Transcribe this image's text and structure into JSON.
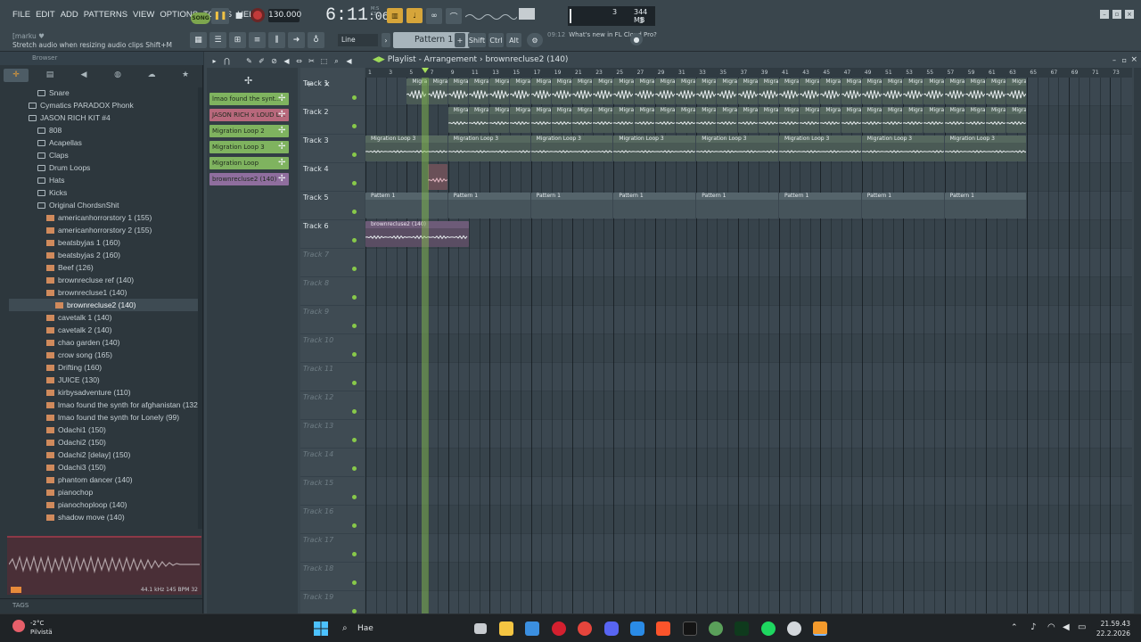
{
  "menu": [
    "FILE",
    "EDIT",
    "ADD",
    "PATTERNS",
    "VIEW",
    "OPTIONS",
    "TOOLS",
    "HELP"
  ],
  "hint": {
    "user": "[marku ♥",
    "text": "Stretch audio when resizing audio clips  Shift+M"
  },
  "transport": {
    "song_label": "SONG",
    "tempo": "130.000",
    "time_main": "6:11",
    "time_small": ":06",
    "time_unit_m": "M:S",
    "time_unit_cs": "CS"
  },
  "cpu": {
    "v1": "3",
    "v2": "344 MB",
    "v3": "3"
  },
  "toolbar2": {
    "snap": "Line",
    "pattern": "Pattern 1",
    "keys": [
      "Shift",
      "Ctrl",
      "Alt"
    ],
    "news_time": "09:12",
    "news_text": "What's new in FL Cloud Pro?"
  },
  "browser": {
    "title": "Browser",
    "tree": [
      {
        "label": "Snare",
        "type": "folder",
        "indent": 1
      },
      {
        "label": "Cymatics PARADOX Phonk",
        "type": "folder",
        "indent": 0
      },
      {
        "label": "JASON RICH KIT #4",
        "type": "folder",
        "indent": 0
      },
      {
        "label": "808",
        "type": "folder",
        "indent": 1
      },
      {
        "label": "Acapellas",
        "type": "folder",
        "indent": 1
      },
      {
        "label": "Claps",
        "type": "folder",
        "indent": 1
      },
      {
        "label": "Drum Loops",
        "type": "folder",
        "indent": 1
      },
      {
        "label": "Hats",
        "type": "folder",
        "indent": 1
      },
      {
        "label": "Kicks",
        "type": "folder",
        "indent": 1
      },
      {
        "label": "Original ChordsnShit",
        "type": "folder",
        "indent": 1
      },
      {
        "label": "americanhorrorstory 1 (155)",
        "type": "file",
        "indent": 2
      },
      {
        "label": "americanhorrorstory 2 (155)",
        "type": "file",
        "indent": 2
      },
      {
        "label": "beatsbyjas 1 (160)",
        "type": "file",
        "indent": 2
      },
      {
        "label": "beatsbyjas 2 (160)",
        "type": "file",
        "indent": 2
      },
      {
        "label": "Beef (126)",
        "type": "file",
        "indent": 2
      },
      {
        "label": "brownrecluse ref (140)",
        "type": "file",
        "indent": 2
      },
      {
        "label": "brownrecluse1 (140)",
        "type": "file",
        "indent": 2
      },
      {
        "label": "brownrecluse2 (140)",
        "type": "file",
        "indent": 3,
        "selected": true
      },
      {
        "label": "cavetalk 1 (140)",
        "type": "file",
        "indent": 2
      },
      {
        "label": "cavetalk 2 (140)",
        "type": "file",
        "indent": 2
      },
      {
        "label": "chao garden (140)",
        "type": "file",
        "indent": 2
      },
      {
        "label": "crow song (165)",
        "type": "file",
        "indent": 2
      },
      {
        "label": "Drifting (160)",
        "type": "file",
        "indent": 2
      },
      {
        "label": "JUICE (130)",
        "type": "file",
        "indent": 2
      },
      {
        "label": "kirbysadventure (110)",
        "type": "file",
        "indent": 2
      },
      {
        "label": "lmao found the synth for afghanistan (132)",
        "type": "file",
        "indent": 2
      },
      {
        "label": "lmao found the synth for Lonely (99)",
        "type": "file",
        "indent": 2
      },
      {
        "label": "Odachi1 (150)",
        "type": "file",
        "indent": 2
      },
      {
        "label": "Odachi2 (150)",
        "type": "file",
        "indent": 2
      },
      {
        "label": "Odachi2 [delay] (150)",
        "type": "file",
        "indent": 2
      },
      {
        "label": "Odachi3 (150)",
        "type": "file",
        "indent": 2
      },
      {
        "label": "phantom dancer (140)",
        "type": "file",
        "indent": 2
      },
      {
        "label": "pianochop",
        "type": "file",
        "indent": 2
      },
      {
        "label": "pianochoploop (140)",
        "type": "file",
        "indent": 2
      },
      {
        "label": "shadow move (140)",
        "type": "file",
        "indent": 2
      }
    ],
    "preview_info": "44.1 kHz 145 BPM 32",
    "tags_label": "TAGS"
  },
  "playlist": {
    "title": "Playlist - Arrangement",
    "title_sep": "›",
    "current": "brownrecluse2 (140)",
    "picker": [
      {
        "label": "lmao found the synt...",
        "color": "#7fb35f"
      },
      {
        "label": "JASON RICH x LOUD L...",
        "color": "#b8687c"
      },
      {
        "label": "Migration Loop 2",
        "color": "#7fb35f"
      },
      {
        "label": "Migration Loop 3",
        "color": "#7fb35f"
      },
      {
        "label": "Migration Loop",
        "color": "#7fb35f"
      },
      {
        "label": "brownrecluse2 (140)",
        "color": "#8f6e9e"
      }
    ],
    "ruler": [
      "1",
      "3",
      "5",
      "7",
      "9",
      "11",
      "13",
      "15",
      "17",
      "19",
      "21",
      "23",
      "25",
      "27",
      "29",
      "31",
      "33",
      "35",
      "37",
      "39",
      "41",
      "43",
      "45",
      "47",
      "49",
      "51",
      "53",
      "55",
      "57",
      "59",
      "61",
      "63",
      "65",
      "67",
      "69",
      "71",
      "73"
    ],
    "tracks": [
      "Track 1",
      "Track 2",
      "Track 3",
      "Track 4",
      "Track 5",
      "Track 6",
      "Track 7",
      "Track 8",
      "Track 9",
      "Track 10",
      "Track 11",
      "Track 12",
      "Track 13",
      "Track 14",
      "Track 15",
      "Track 16",
      "Track 17",
      "Track 18",
      "Track 19"
    ],
    "clip_labels": {
      "t1": "Migra...Loop",
      "t2": "Migra...op 2",
      "t3": "Migration Loop 3",
      "t5": "Pattern 1",
      "t6": "brownrecluse2 (140)"
    }
  },
  "taskbar": {
    "temp": "-2°C",
    "weather": "Pilvistä",
    "search": "Hae",
    "time": "21.59.43",
    "date": "22.2.2026"
  }
}
